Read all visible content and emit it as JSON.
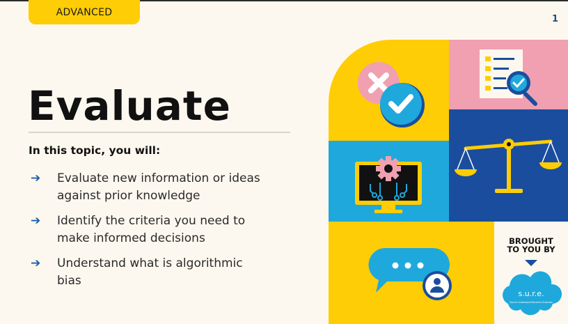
{
  "badge": "ADVANCED",
  "page_number": "1",
  "title": "Evaluate",
  "subheading": "In this topic, you will:",
  "bullets": [
    {
      "arrow": "➔",
      "text": "Evaluate new information or ideas against prior knowledge"
    },
    {
      "arrow": "➔",
      "text": "Identify the criteria you need to make informed decisions"
    },
    {
      "arrow": "➔",
      "text": "Understand what is algorithmic bias"
    }
  ],
  "sponsor": {
    "line1": "BROUGHT",
    "line2": "TO YOU BY",
    "logo_text": "s.u.r.e.",
    "logo_subtext": "Source-Understand-Research-Evaluate"
  },
  "colors": {
    "yellow": "#ffcd05",
    "pink": "#f0a0b0",
    "light_blue": "#1fa8dc",
    "dark_blue": "#1a4d9e",
    "cream": "#fdf8ef"
  },
  "icons": [
    "cross-check-icon",
    "checklist-magnifier-icon",
    "monitor-gear-icon",
    "scales-icon",
    "chat-user-icon",
    "sure-logo-icon"
  ]
}
